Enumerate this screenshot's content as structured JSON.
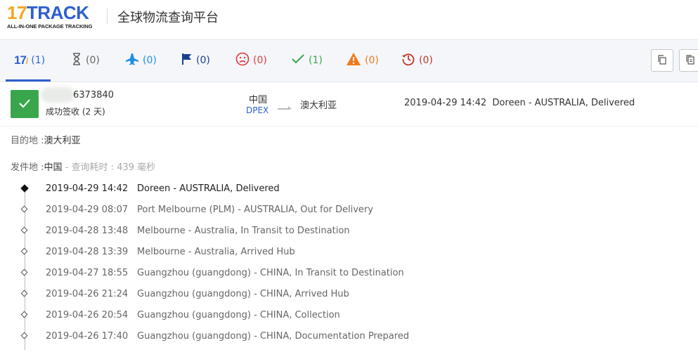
{
  "header": {
    "logo_text": "17TRACK",
    "logo_sub": "ALL-IN-ONE PACKAGE TRACKING",
    "title": "全球物流查询平台"
  },
  "tabs": [
    {
      "name": "all",
      "icon": "17track-logo-icon",
      "count": "(1)",
      "color": "#2f5fd0"
    },
    {
      "name": "not-found",
      "icon": "hourglass-icon",
      "count": "(0)",
      "color": "#666666"
    },
    {
      "name": "in-transit",
      "icon": "airplane-icon",
      "count": "(0)",
      "color": "#1e90e6"
    },
    {
      "name": "pickup",
      "icon": "flag-icon",
      "count": "(0)",
      "color": "#1a3f8f"
    },
    {
      "name": "undelivered",
      "icon": "sad-face-icon",
      "count": "(0)",
      "color": "#e03a3a"
    },
    {
      "name": "delivered",
      "icon": "checkmark-icon",
      "count": "(1)",
      "color": "#3aa64c"
    },
    {
      "name": "alert",
      "icon": "warning-icon",
      "count": "(0)",
      "color": "#f07a1a"
    },
    {
      "name": "expired",
      "icon": "history-icon",
      "count": "(0)",
      "color": "#c0392b"
    }
  ],
  "summary": {
    "tracking_no": "6373840",
    "status": "成功签收 (2 天)",
    "origin": "中国",
    "carrier": "DPEX",
    "destination": "澳大利亚",
    "latest_time": "2019-04-29 14:42",
    "latest_event": "Doreen - AUSTRALIA, Delivered"
  },
  "details": {
    "dest_label": "目的地 :",
    "dest_value": "澳大利亚",
    "origin_label": "发件地 :",
    "origin_value": "中国",
    "query_time": "- 查询耗时 : 439 毫秒"
  },
  "events": [
    {
      "time": "2019-04-29 14:42",
      "desc": "Doreen - AUSTRALIA, Delivered"
    },
    {
      "time": "2019-04-29 08:07",
      "desc": "Port Melbourne (PLM) - AUSTRALIA, Out for Delivery"
    },
    {
      "time": "2019-04-28 13:48",
      "desc": "Melbourne - Australia, In Transit to Destination"
    },
    {
      "time": "2019-04-28 13:39",
      "desc": "Melbourne - Australia, Arrived Hub"
    },
    {
      "time": "2019-04-27 18:55",
      "desc": "Guangzhou (guangdong) - CHINA, In Transit to Destination"
    },
    {
      "time": "2019-04-26 21:24",
      "desc": "Guangzhou (guangdong) - CHINA, Arrived Hub"
    },
    {
      "time": "2019-04-26 20:54",
      "desc": "Guangzhou (guangdong) - CHINA, Collection"
    },
    {
      "time": "2019-04-26 17:40",
      "desc": "Guangzhou (guangdong) - CHINA, Documentation Prepared"
    }
  ]
}
